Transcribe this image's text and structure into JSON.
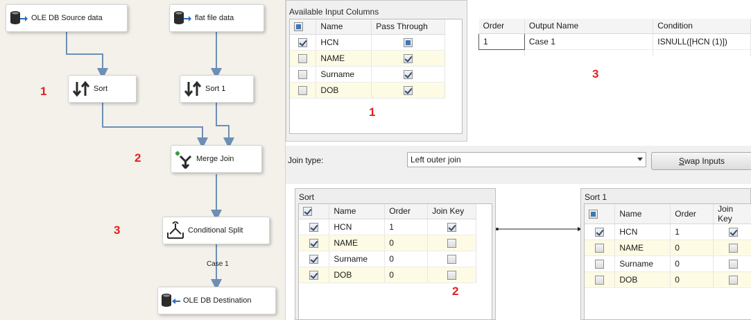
{
  "flow": {
    "nodes": {
      "oledb_source": "OLE DB Source data",
      "flat_file": "flat file data",
      "sort": "Sort",
      "sort1": "Sort 1",
      "merge_join": "Merge Join",
      "conditional_split": "Conditional Split",
      "oledb_destination": "OLE DB Destination"
    },
    "path_label": "Case 1",
    "annotations": [
      "1",
      "2",
      "3"
    ]
  },
  "available_columns": {
    "title": "Available Input Columns",
    "headers": [
      "Name",
      "Pass Through"
    ],
    "rows": [
      {
        "name": "HCN",
        "selected": true,
        "pass_through": "partial"
      },
      {
        "name": "NAME",
        "selected": false,
        "pass_through": "checked"
      },
      {
        "name": "Surname",
        "selected": false,
        "pass_through": "checked"
      },
      {
        "name": "DOB",
        "selected": false,
        "pass_through": "checked"
      }
    ],
    "annotation": "1"
  },
  "conditions": {
    "headers": [
      "Order",
      "Output Name",
      "Condition"
    ],
    "rows": [
      {
        "order": "1",
        "output": "Case 1",
        "condition": "ISNULL([HCN (1)])"
      }
    ],
    "annotation": "3"
  },
  "join": {
    "type_label": "Join type:",
    "type_value": "Left outer join",
    "swap_button_prefix": "",
    "swap_button_underlined": "S",
    "swap_button_rest": "wap Inputs",
    "annotation": "2",
    "left": {
      "title": "Sort",
      "headers": [
        "Name",
        "Order",
        "Join Key"
      ],
      "rows": [
        {
          "name": "HCN",
          "order": "1",
          "selected": true,
          "join_key": true
        },
        {
          "name": "NAME",
          "order": "0",
          "selected": true,
          "join_key": false
        },
        {
          "name": "Surname",
          "order": "0",
          "selected": true,
          "join_key": false
        },
        {
          "name": "DOB",
          "order": "0",
          "selected": true,
          "join_key": false
        }
      ]
    },
    "right": {
      "title": "Sort 1",
      "headers": [
        "Name",
        "Order",
        "Join Key"
      ],
      "rows": [
        {
          "name": "HCN",
          "order": "1",
          "selected": true,
          "join_key": true
        },
        {
          "name": "NAME",
          "order": "0",
          "selected": false,
          "join_key": false
        },
        {
          "name": "Surname",
          "order": "0",
          "selected": false,
          "join_key": false
        },
        {
          "name": "DOB",
          "order": "0",
          "selected": false,
          "join_key": false
        }
      ]
    }
  },
  "colors": {
    "annotation_red": "#e02020",
    "connector_blue": "#6d8fb5",
    "alt_row": "#fdfbe4"
  }
}
